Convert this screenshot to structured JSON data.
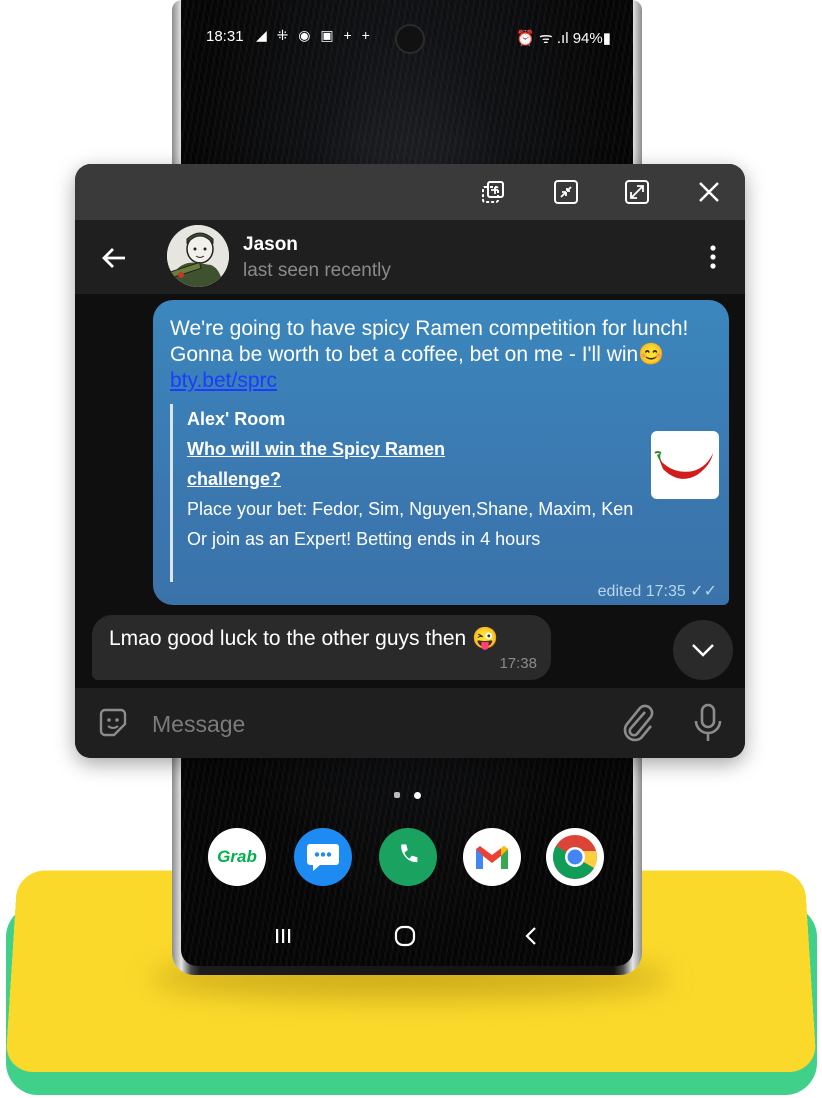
{
  "status_bar": {
    "time": "18:31",
    "icons": "◢ ⁜ ◉ ▣ + +",
    "right": "⏰ ᯤ .ıl 94%▮"
  },
  "window_controls": {
    "picture_in_picture_icon": "pip-icon",
    "minimize_icon": "minimize-icon",
    "maximize_icon": "maximize-icon",
    "close_icon": "close-icon"
  },
  "chat_header": {
    "name": "Jason",
    "status": "last seen recently"
  },
  "messages": {
    "outgoing": {
      "text_before_link": "We're going to have spicy Ramen competition for lunch! Gonna be worth to bet a coffee, bet on me - I'll win",
      "emoji": "😊",
      "link": "bty.bet/sprc",
      "preview": {
        "site": "Alex' Room",
        "title": "Who will win the Spicy Ramen challenge?",
        "line1": "Place your bet: Fedor, Sim, Nguyen,Shane, Maxim, Ken",
        "line2": "Or join as an Expert! Betting ends in 4 hours"
      },
      "meta": "edited 17:35 ✓✓"
    },
    "incoming": {
      "text": "Lmao good luck to the other guys then",
      "emoji": "😜",
      "time": "17:38"
    }
  },
  "composer": {
    "placeholder": "Message"
  },
  "dock_apps": [
    "Grab",
    "Messages",
    "Phone",
    "Gmail",
    "Chrome"
  ],
  "colors": {
    "outgoing_bubble": "#3b82b8",
    "platform_yellow": "#fbd92b",
    "platform_green": "#40d08a"
  }
}
